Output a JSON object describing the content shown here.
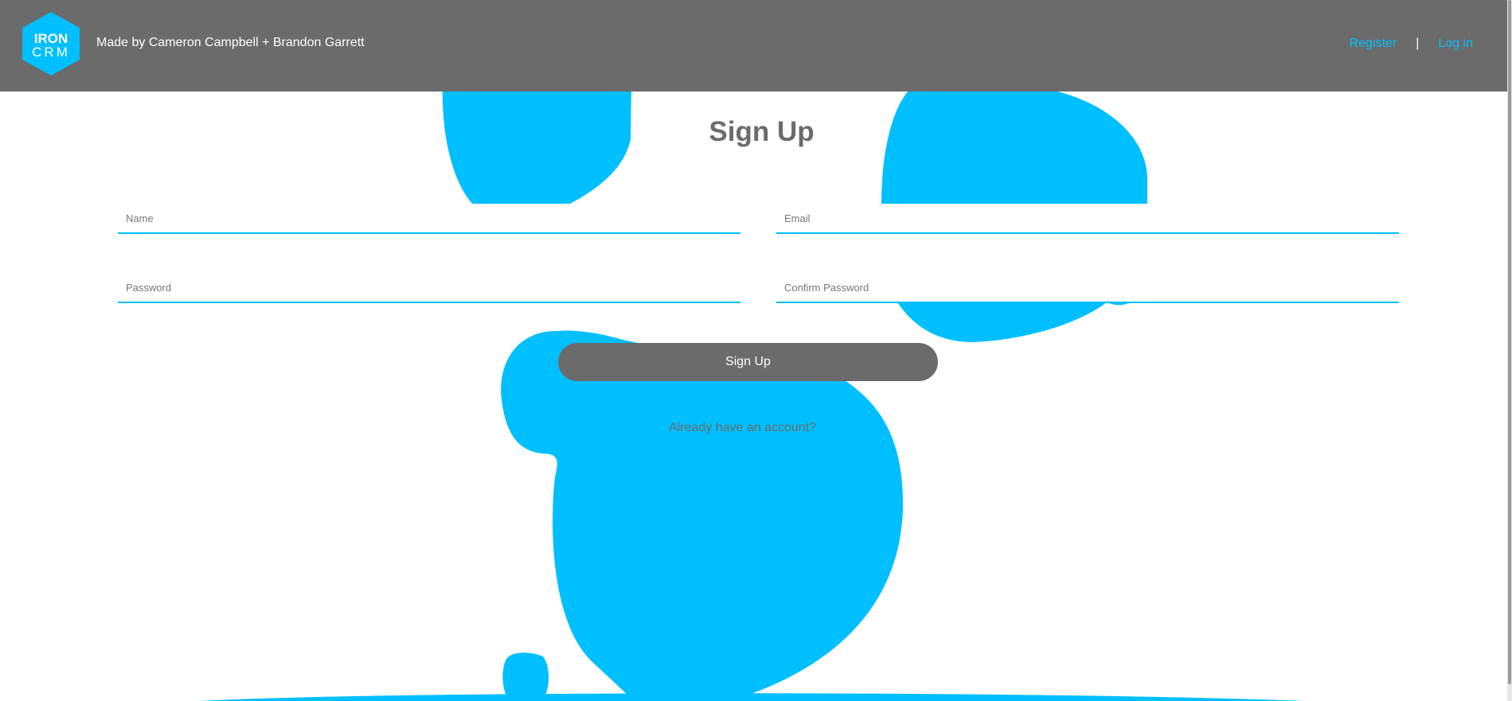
{
  "header": {
    "logo": {
      "icon": "iron-crm-hexagon-logo",
      "line1": "IRON",
      "line2": "CRM"
    },
    "credits": "Made by Cameron Campbell + Brandon Garrett",
    "nav": {
      "register": "Register",
      "separator": "|",
      "login": "Log in"
    }
  },
  "form": {
    "title": "Sign Up",
    "name_placeholder": "Name",
    "email_placeholder": "Email",
    "password_placeholder": "Password",
    "confirm_placeholder": "Confirm Password",
    "submit_label": "Sign Up",
    "account_link": "Already have an account?"
  },
  "colors": {
    "accent": "#00bfff",
    "header": "#6b6b6b",
    "button": "#6b6b6b"
  }
}
